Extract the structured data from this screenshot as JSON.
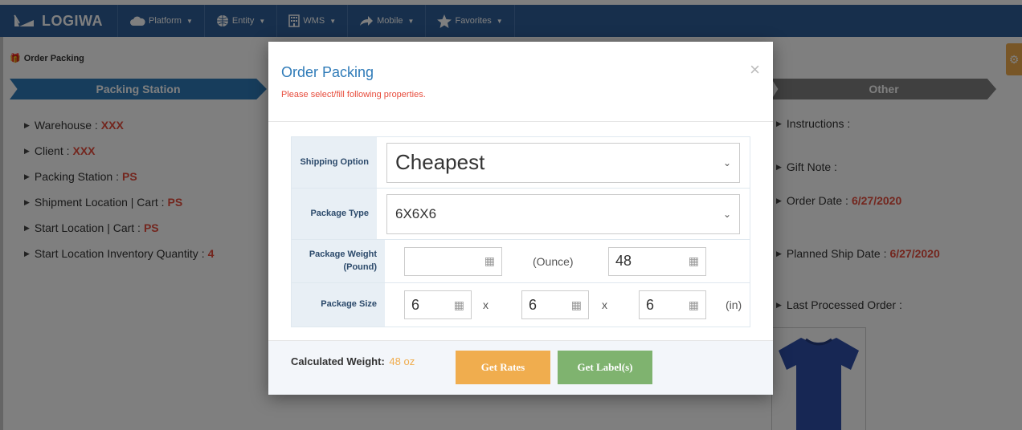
{
  "nav": {
    "brand": "LOGIWA",
    "items": [
      {
        "label": "Platform",
        "icon": "cloud-icon"
      },
      {
        "label": "Entity",
        "icon": "globe-icon"
      },
      {
        "label": "WMS",
        "icon": "building-icon"
      },
      {
        "label": "Mobile",
        "icon": "share-arrow-icon"
      },
      {
        "label": "Favorites",
        "icon": "star-icon"
      }
    ]
  },
  "page": {
    "breadcrumb": "Order Packing",
    "steps": {
      "left": "Packing Station",
      "right": "Other"
    },
    "left_fields": [
      {
        "label": "Warehouse :",
        "value": "XXX"
      },
      {
        "label": "Client :",
        "value": "XXX"
      },
      {
        "label": "Packing Station :",
        "value": "PS"
      },
      {
        "label": "Shipment Location | Cart :",
        "value": "PS"
      },
      {
        "label": "Start Location | Cart :",
        "value": "PS"
      },
      {
        "label": "Start Location Inventory Quantity :",
        "value": "4"
      }
    ],
    "right_fields": [
      {
        "label": "Instructions :",
        "value": ""
      },
      {
        "label": "Gift Note :",
        "value": ""
      },
      {
        "label": "Order Date :",
        "value": "6/27/2020"
      },
      {
        "label": "Planned Ship Date :",
        "value": "6/27/2020"
      },
      {
        "label": "Last Processed Order :",
        "value": ""
      }
    ]
  },
  "modal": {
    "title": "Order Packing",
    "subtitle": "Please select/fill following properties.",
    "close": "×",
    "shipping_option": {
      "label": "Shipping Option",
      "value": "Cheapest"
    },
    "package_type": {
      "label": "Package Type",
      "value": "6X6X6"
    },
    "package_weight": {
      "label": "Package Weight (Pound)",
      "pound_value": "",
      "unit": "(Ounce)",
      "ounce_value": "48"
    },
    "package_size": {
      "label": "Package Size",
      "x": "6",
      "y": "6",
      "z": "6",
      "sep": "x",
      "unit": "(in)"
    },
    "calculated_label": "Calculated Weight:",
    "calculated_value": "48 oz",
    "get_rates": "Get Rates",
    "get_labels": "Get Label(s)"
  },
  "colors": {
    "nav": "#2f5f98",
    "accent": "#2f7bb8",
    "warn": "#f0ad4e",
    "success": "#7fb36f",
    "error": "#e74c3c"
  }
}
